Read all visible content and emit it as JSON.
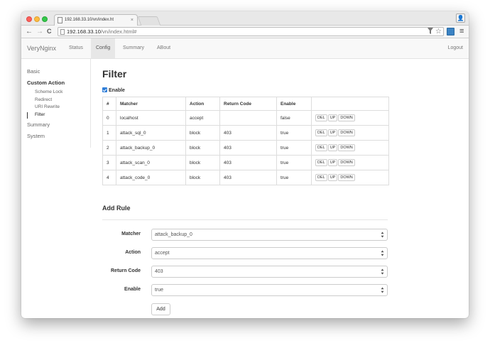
{
  "browser": {
    "tab_title": "192.168.33.10/vn/index.ht",
    "tab_close": "×",
    "url_host": "192.168.33.10",
    "url_path": "/vn/index.html#",
    "back_glyph": "←",
    "forward_glyph": "→",
    "reload_glyph": "C",
    "menu_glyph": "≡",
    "profile_glyph": "👤"
  },
  "app": {
    "brand": "VeryNginx",
    "nav": [
      "Status",
      "Config",
      "Summary",
      "ABout"
    ],
    "active_nav": "Config",
    "logout": "Logout"
  },
  "sidebar": {
    "basic": "Basic",
    "custom_action": "Custom Action",
    "sub_items": [
      "Scheme Lock",
      "Redirect",
      "URI Rewrite",
      "Filter"
    ],
    "active_sub": "Filter",
    "summary": "Summary",
    "system": "System"
  },
  "filter": {
    "title": "Filter",
    "enable_label": "Enable",
    "enabled": true,
    "columns": [
      "#",
      "Matcher",
      "Action",
      "Return Code",
      "Enable",
      ""
    ],
    "rows": [
      {
        "idx": "0",
        "matcher": "localhost",
        "action": "accept",
        "code": "",
        "enable": "false"
      },
      {
        "idx": "1",
        "matcher": "attack_sql_0",
        "action": "block",
        "code": "403",
        "enable": "true"
      },
      {
        "idx": "2",
        "matcher": "attack_backup_0",
        "action": "block",
        "code": "403",
        "enable": "true"
      },
      {
        "idx": "3",
        "matcher": "attack_scan_0",
        "action": "block",
        "code": "403",
        "enable": "true"
      },
      {
        "idx": "4",
        "matcher": "attack_code_0",
        "action": "block",
        "code": "403",
        "enable": "true"
      }
    ],
    "row_buttons": [
      "DEL",
      "UP",
      "DOWN"
    ]
  },
  "add_rule": {
    "title": "Add Rule",
    "fields": [
      {
        "label": "Matcher",
        "value": "attack_backup_0"
      },
      {
        "label": "Action",
        "value": "accept"
      },
      {
        "label": "Return Code",
        "value": "403"
      },
      {
        "label": "Enable",
        "value": "true"
      }
    ],
    "submit": "Add"
  },
  "colors": {
    "checkbox": "#2f7ed8",
    "navbar_bg": "#f8f8f8",
    "border": "#dddddd"
  }
}
